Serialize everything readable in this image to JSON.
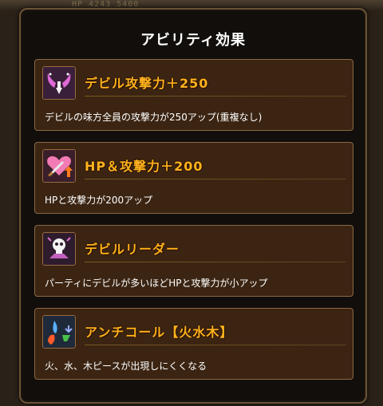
{
  "background": {
    "hp_text": "HP  4243        5400"
  },
  "dialog": {
    "title": "アビリティ効果",
    "abilities": [
      {
        "icon": "devil-wings-attack-icon",
        "title": "デビル攻撃力＋250",
        "description": "デビルの味方全員の攻撃力が250アップ(重複なし)"
      },
      {
        "icon": "heart-sword-icon",
        "title": "HP＆攻撃力＋200",
        "description": "HPと攻撃力が200アップ"
      },
      {
        "icon": "skull-leader-icon",
        "title": "デビルリーダー",
        "description": "パーティにデビルが多いほどHPと攻撃力が小アップ"
      },
      {
        "icon": "anti-combo-elements-icon",
        "title": "アンチコール【火水木】",
        "description": "火、水、木ピースが出現しにくくなる"
      }
    ]
  },
  "colors": {
    "title_accent": "#ffb21c",
    "panel_border": "#6b5436",
    "card_bg": "#3b2412"
  }
}
